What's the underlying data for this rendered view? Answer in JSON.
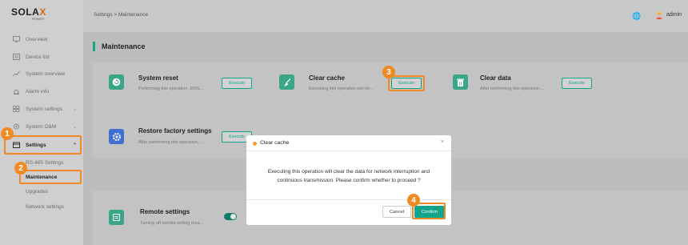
{
  "brand": {
    "name_prefix": "SOLA",
    "name_suffix": "X",
    "sub": "POWER"
  },
  "sidebar": {
    "items": [
      {
        "label": "Overview",
        "icon": "monitor-icon"
      },
      {
        "label": "Device list",
        "icon": "list-icon"
      },
      {
        "label": "System overview",
        "icon": "chart-icon"
      },
      {
        "label": "Alarm info",
        "icon": "alarm-icon"
      },
      {
        "label": "System settings",
        "icon": "grid-icon"
      },
      {
        "label": "System O&M",
        "icon": "maintenance-icon"
      },
      {
        "label": "Settings",
        "icon": "settings-icon"
      }
    ],
    "subitems": [
      {
        "label": "RS-485 Settings"
      },
      {
        "label": "Maintenance"
      },
      {
        "label": "Upgrades"
      },
      {
        "label": "Network settings"
      }
    ]
  },
  "topbar": {
    "breadcrumb": "Settings > Maintenance",
    "user": "admin"
  },
  "main": {
    "title": "Maintenance",
    "cards": [
      {
        "title": "System reset",
        "desc": "Performing this operation, EMS...",
        "button": "Execute"
      },
      {
        "title": "Clear cache",
        "desc": "Executing this operation will cle...",
        "button": "Execute"
      },
      {
        "title": "Clear data",
        "desc": "After performing this operation,...",
        "button": "Execute"
      },
      {
        "title": "Restore factory settings",
        "desc": "After performing this operation,...",
        "button": "Execute"
      }
    ],
    "remote": {
      "title": "Remote settings",
      "desc": "Turning off remote setting mea..."
    }
  },
  "modal": {
    "title": "Clear cache",
    "close": "×",
    "body": "Executing this operation will clear the data for network interruption and continuous transmission. Please confirm whether to proceed ?",
    "cancel": "Cancel",
    "confirm": "Confirm"
  },
  "steps": [
    "1",
    "2",
    "3",
    "4"
  ],
  "colors": {
    "accent": "#12a58b",
    "highlight": "#f08a24",
    "toggle": "#0e7d6a"
  }
}
